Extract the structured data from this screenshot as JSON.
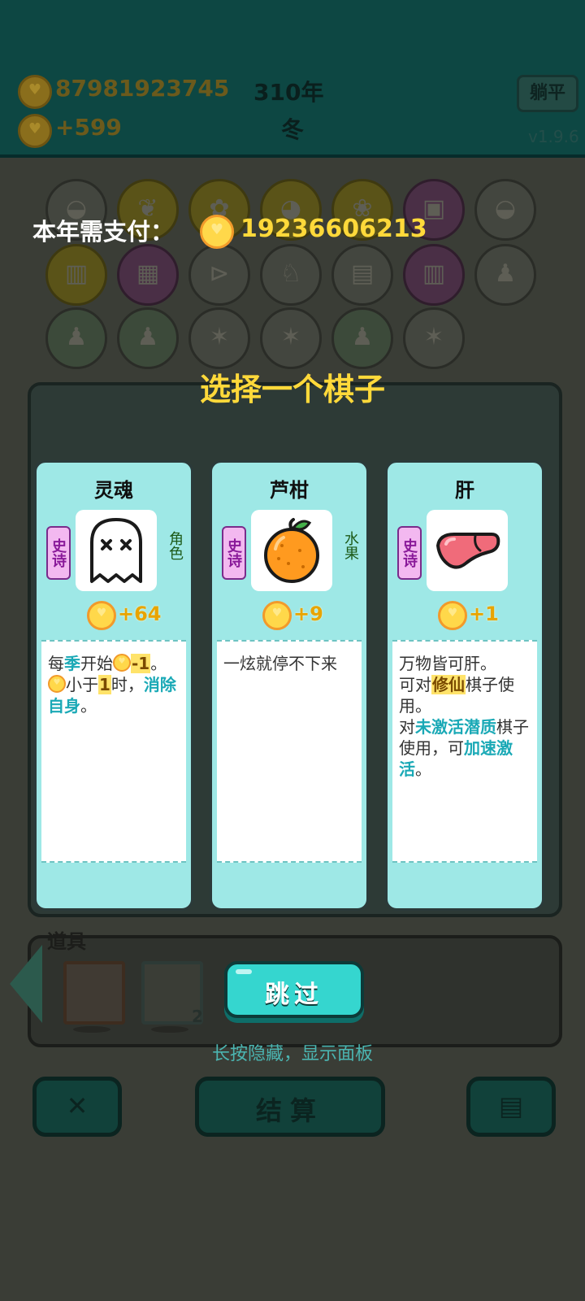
{
  "header": {
    "coins": "87981923745",
    "income": "+599",
    "year": "310年",
    "season": "冬",
    "flat_button": "躺平",
    "version": "v1.9.6"
  },
  "overlay": {
    "pay_label": "本年需支付：",
    "pay_amount": "19236606213",
    "choose_title": "选择一个棋子",
    "skip_button": "跳过",
    "hint": "长按隐藏，显示面板"
  },
  "cards": [
    {
      "name": "灵魂",
      "rarity": "史诗",
      "category": "角色",
      "gain": "+64",
      "desc_parts": [
        "每",
        "季",
        "开始",
        "-1",
        "。",
        "小于",
        "1",
        "时，",
        "消除自身",
        "。"
      ]
    },
    {
      "name": "芦柑",
      "rarity": "史诗",
      "category": "水果",
      "gain": "+9",
      "desc_parts": [
        "一炫就停不下来"
      ]
    },
    {
      "name": "肝",
      "rarity": "史诗",
      "category": "",
      "gain": "+1",
      "desc_parts": [
        "万物皆可肝。",
        "可对",
        "修仙",
        "棋子使用。",
        "对",
        "未激活潜质",
        "棋子使用，可",
        "加速激活",
        "。"
      ]
    }
  ],
  "props": {
    "title": "道具",
    "count": "2"
  },
  "bottom": {
    "settle": "结算"
  },
  "colors": {
    "card_bg": "#9ee8e6",
    "gold": "#ffd93a",
    "cyan_highlight": "#1aa9b6",
    "rarity_purple": "#8a1a9a"
  }
}
